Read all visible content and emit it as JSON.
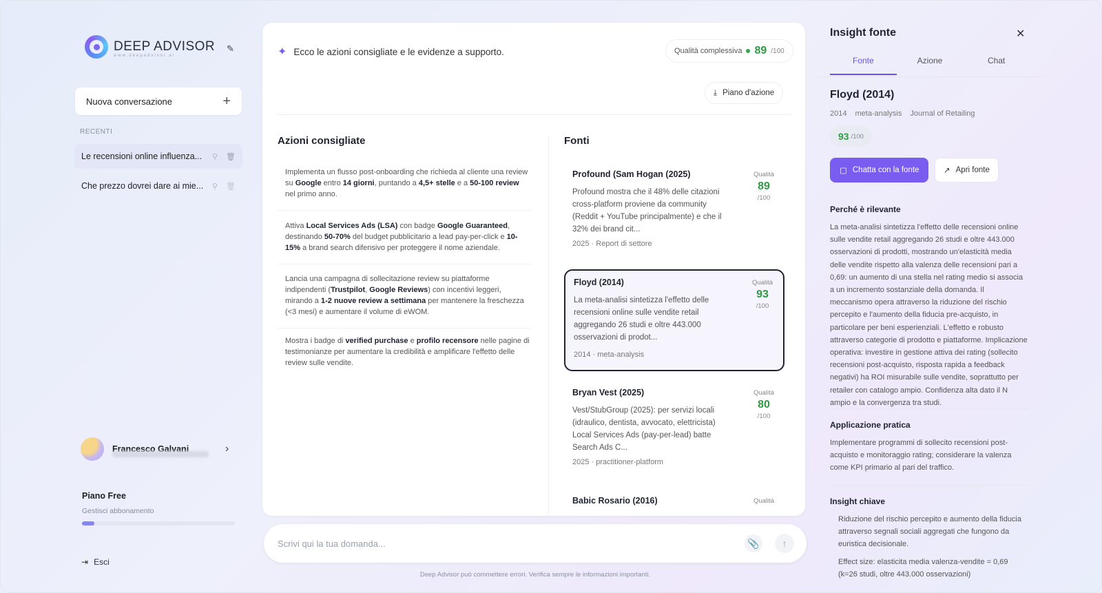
{
  "sidebar": {
    "logo_text": "DEEP ADVISOR",
    "logo_sub": "www.deepadvisor.ai",
    "new_chat_label": "Nuova conversazione",
    "recent_heading": "RECENTI",
    "conversations": [
      {
        "title": "Le recensioni online influenza...",
        "active": true
      },
      {
        "title": "Che prezzo dovrei dare ai mie...",
        "active": false
      }
    ],
    "user": {
      "name": "Francesco Galvani"
    },
    "plan": {
      "name": "Piano Free",
      "manage_label": "Gestisci abbonamento",
      "usage_fraction": 0.08
    },
    "logout_label": "Esci"
  },
  "main": {
    "header_text": "Ecco le azioni consigliate e le evidenze a supporto.",
    "quality": {
      "label": "Qualità complessiva",
      "value": "89",
      "denominator": "/100"
    },
    "plan_button_label": "Piano d'azione",
    "actions_title": "Azioni consigliate",
    "sources_title": "Fonti",
    "actions": [
      {
        "html": "Implementa un flusso post-onboarding che richieda al cliente una review su <b>Google</b> entro <b>14 giorni</b>, puntando a <b>4,5+ stelle</b> e a <b>50-100 review</b> nel primo anno."
      },
      {
        "html": "Attiva <b>Local Services Ads (LSA)</b> con badge <b>Google Guaranteed</b>, destinando <b>50-70%</b> del budget pubblicitario a lead pay-per-click e <b>10-15%</b> a brand search difensivo per proteggere il nome aziendale."
      },
      {
        "html": "Lancia una campagna di sollecitazione review su piattaforme indipendenti (<b>Trustpilot</b>, <b>Google Reviews</b>) con incentivi leggeri, mirando a <b>1-2 nuove review a settimana</b> per mantenere la freschezza (&lt;3 mesi) e aumentare il volume di eWOM."
      },
      {
        "html": "Mostra i badge di <b>verified purchase</b> e <b>profilo recensore</b> nelle pagine di testimonianze per aumentare la credibilità e amplificare l'effetto delle review sulle vendite."
      }
    ],
    "sources": [
      {
        "title": "Profound (Sam Hogan (2025)",
        "desc": "Profound mostra che il 48% delle citazioni cross-platform proviene da community (Reddit + YouTube principalmente) e che il 32% dei brand cit...",
        "year": "2025",
        "type": "Report di settore",
        "quality_label": "Qualità",
        "quality": "89",
        "den": "/100",
        "selected": false
      },
      {
        "title": "Floyd (2014)",
        "desc": "La meta-analisi sintetizza l'effetto delle recensioni online sulle vendite retail aggregando 26 studi e oltre 443.000 osservazioni di prodot...",
        "year": "2014",
        "type": "meta-analysis",
        "quality_label": "Qualità",
        "quality": "93",
        "den": "/100",
        "selected": true
      },
      {
        "title": "Bryan Vest (2025)",
        "desc": "Vest/StubGroup (2025): per servizi locali (idraulico, dentista, avvocato, elettricista) Local Services Ads (pay-per-lead) batte Search Ads C...",
        "year": "2025",
        "type": "practitioner-platform",
        "quality_label": "Qualità",
        "quality": "80",
        "den": "/100",
        "selected": false
      },
      {
        "title": "Babic Rosario (2016)",
        "desc": "",
        "year": "",
        "type": "",
        "quality_label": "Qualità",
        "quality": "",
        "den": "",
        "selected": false
      }
    ],
    "input_placeholder": "Scrivi qui la tua domanda...",
    "disclaimer": "Deep Advisor può commettere errori. Verifica sempre le informazioni importanti."
  },
  "panel": {
    "title": "Insight fonte",
    "tabs": [
      "Fonte",
      "Azione",
      "Chat"
    ],
    "active_tab": "Fonte",
    "source_title": "Floyd (2014)",
    "meta": [
      "2014",
      "meta-analysis",
      "Journal of Retailing"
    ],
    "quality": "93",
    "quality_den": "/100",
    "chat_button": "Chatta con la fonte",
    "open_button": "Apri fonte",
    "why_heading": "Perché è rilevante",
    "why_text": "La meta-analisi sintetizza l'effetto delle recensioni online sulle vendite retail aggregando 26 studi e oltre 443.000 osservazioni di prodotti, mostrando un'elasticità media delle vendite rispetto alla valenza delle recensioni pari a 0,69: un aumento di una stella nel rating medio si associa a un incremento sostanziale della domanda. Il meccanismo opera attraverso la riduzione del rischio percepito e l'aumento della fiducia pre-acquisto, in particolare per beni esperienziali. L'effetto e robusto attraverso categorie di prodotto e piattaforme. Implicazione operativa: investire in gestione attiva dei rating (sollecito recensioni post-acquisto, risposta rapida a feedback negativi) ha ROI misurabile sulle vendite, soprattutto per retailer con catalogo ampio. Confidenza alta dato il N ampio e la convergenza tra studi.",
    "practical_heading": "Applicazione pratica",
    "practical_text": "Implementare programmi di sollecito recensioni post-acquisto e monitoraggio rating; considerare la valenza come KPI primario al pari del traffico.",
    "insight_heading": "Insight chiave",
    "insights": [
      "Riduzione del rischio percepito e aumento della fiducia attraverso segnali sociali aggregati che fungono da euristica decisionale.",
      "Effect size: elasticita media valenza-vendite = 0,69 (k=26 studi, oltre 443.000 osservazioni)"
    ]
  },
  "colors": {
    "accent": "#7b5cf0",
    "quality_green": "#2f9a44",
    "selected_border": "#1f2330"
  }
}
